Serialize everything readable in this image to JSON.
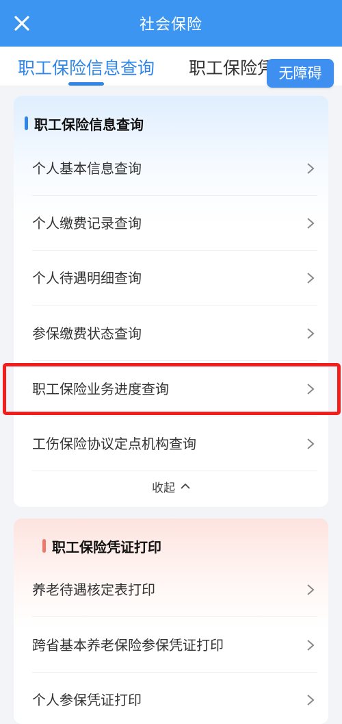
{
  "header": {
    "title": "社会保险",
    "close_icon": "close-icon",
    "bg_color": "#3c95f0"
  },
  "tabs": [
    {
      "label": "职工保险信息查询",
      "active": true
    },
    {
      "label": "职工保险凭证打印",
      "active": false
    }
  ],
  "accessibility_button": "无障碍",
  "sections": [
    {
      "title": "职工保险信息查询",
      "accent": "#2f86e6",
      "items": [
        "个人基本信息查询",
        "个人缴费记录查询",
        "个人待遇明细查询",
        "参保缴费状态查询",
        "职工保险业务进度查询",
        "工伤保险协议定点机构查询"
      ],
      "collapse_label": "收起"
    },
    {
      "title": "职工保险凭证打印",
      "accent": "#ec7a6c",
      "items": [
        "养老待遇核定表打印",
        "跨省基本养老保险参保凭证打印",
        "个人参保凭证打印"
      ]
    }
  ],
  "highlight_color": "#f21d1d"
}
